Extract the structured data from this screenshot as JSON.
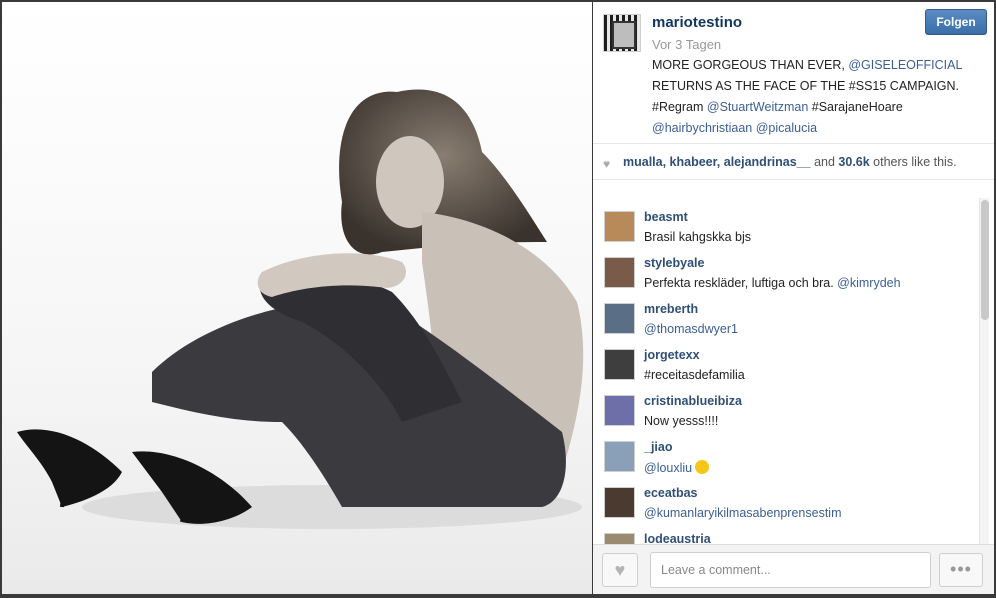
{
  "post": {
    "username": "mariotestino",
    "time_ago": "Vor 3 Tagen",
    "follow_label": "Folgen",
    "caption": [
      {
        "text": "MORE GORGEOUS THAN EVER, ",
        "tag": false
      },
      {
        "text": "@GISELEOFFICIAL",
        "tag": true
      },
      {
        "text": " RETURNS AS THE FACE OF THE #SS15 CAMPAIGN. #Regram ",
        "tag": false
      },
      {
        "text": "@StuartWeitzman",
        "tag": true
      },
      {
        "text": " #SarajaneHoare ",
        "tag": false
      },
      {
        "text": "@hairbychristiaan",
        "tag": true
      },
      {
        "text": " ",
        "tag": false
      },
      {
        "text": "@picalucia",
        "tag": true
      }
    ]
  },
  "likes": {
    "users": "mualla, khabeer, alejandrinas__",
    "mid": " and ",
    "count": "30.6k",
    "tail": " others like this."
  },
  "comments": [
    {
      "user": "beasmt",
      "text": "Brasil kahgskka bjs",
      "mention": "",
      "emoji": false,
      "avatar_color": "#b88a5a"
    },
    {
      "user": "stylebyale",
      "text": "Perfekta reskläder, luftiga och bra. ",
      "mention": "@kimrydeh",
      "emoji": false,
      "avatar_color": "#7a5a48"
    },
    {
      "user": "mreberth",
      "text": "",
      "mention": "@thomasdwyer1",
      "emoji": false,
      "avatar_color": "#5a6e86"
    },
    {
      "user": "jorgetexx",
      "text": "#receitasdefamilia",
      "mention": "",
      "emoji": false,
      "avatar_color": "#3e3e3e"
    },
    {
      "user": "cristinablueibiza",
      "text": "Now yesss!!!!",
      "mention": "",
      "emoji": false,
      "avatar_color": "#6e6ea8"
    },
    {
      "user": "_jiao",
      "text": "",
      "mention": "@louxliu",
      "emoji": true,
      "avatar_color": "#8aa0b8"
    },
    {
      "user": "eceatbas",
      "text": "",
      "mention": "@kumanlaryikilmasabenprensestim",
      "emoji": false,
      "avatar_color": "#4a3a30"
    },
    {
      "user": "lodeaustria",
      "text": "",
      "mention": "",
      "emoji": false,
      "avatar_color": "#9a8a70"
    }
  ],
  "footer": {
    "comment_placeholder": "Leave a comment...",
    "more_label": "•••"
  },
  "icons": {
    "like": "heart-icon",
    "more": "ellipsis-icon"
  }
}
